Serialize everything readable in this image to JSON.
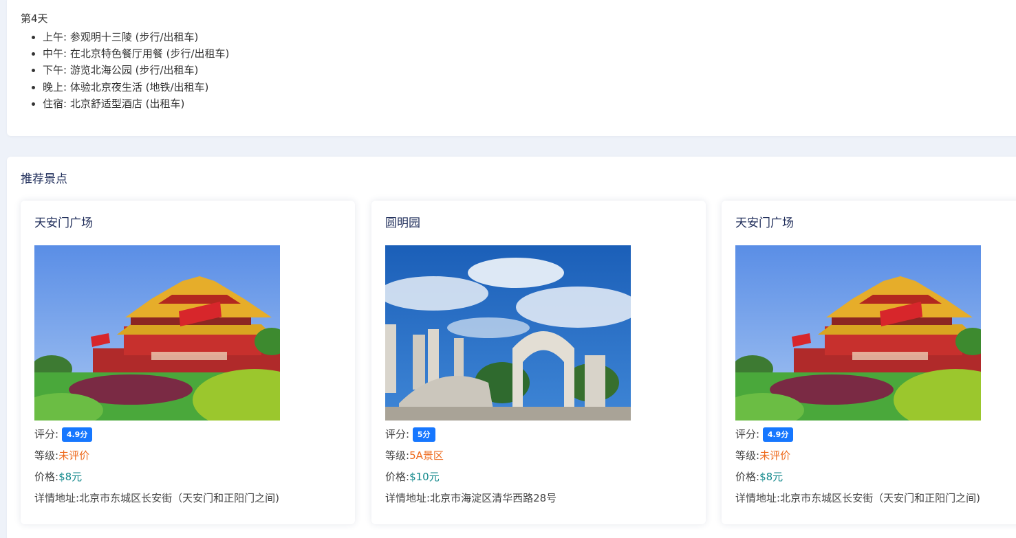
{
  "day": {
    "title": "第4天",
    "items": [
      "上午: 参观明十三陵 (步行/出租车)",
      "中午: 在北京特色餐厅用餐 (步行/出租车)",
      "下午: 游览北海公园 (步行/出租车)",
      "晚上: 体验北京夜生活 (地铁/出租车)",
      "住宿: 北京舒适型酒店 (出租车)"
    ]
  },
  "recommend": {
    "title": "推荐景点",
    "score_label": "评分:",
    "level_label": "等级:",
    "price_label": "价格:",
    "address_label": "详情地址:",
    "cards": [
      {
        "name": "天安门广场",
        "image_alt": "天安门广场",
        "score": "4.9分",
        "level": "未评价",
        "price": "$8元",
        "address": "北京市东城区长安街（天安门和正阳门之间)"
      },
      {
        "name": "圆明园",
        "image_alt": "圆明园",
        "score": "5分",
        "level": "5A景区",
        "price": "$10元",
        "address": "北京市海淀区清华西路28号"
      },
      {
        "name": "天安门广场",
        "image_alt": "天安门广场",
        "score": "4.9分",
        "level": "未评价",
        "price": "$8元",
        "address": "北京市东城区长安街（天安门和正阳门之间)"
      }
    ]
  },
  "colors": {
    "page_background": "#eef2f9",
    "score_badge": "#1677ff",
    "level_text": "#ee6a1d",
    "price_text": "#13898c",
    "heading_text": "#1f2d5a"
  }
}
